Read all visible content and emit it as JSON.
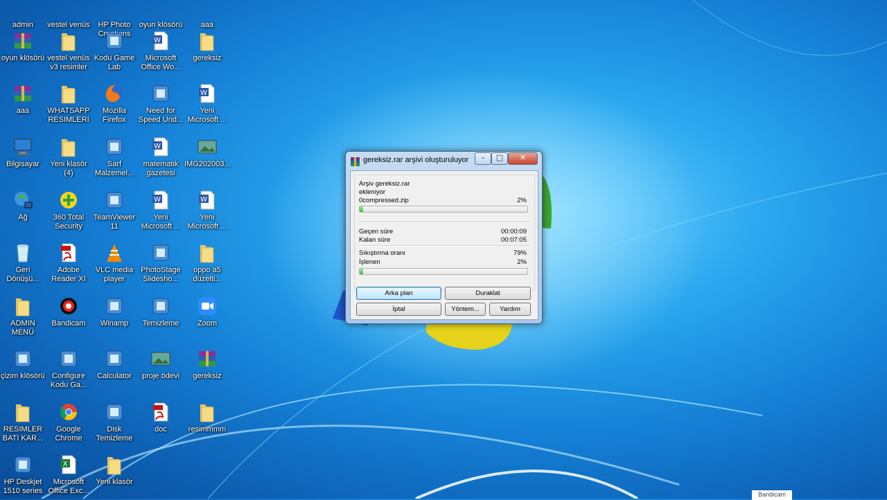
{
  "desktop": {
    "icons": [
      {
        "label": "admin",
        "type": "user"
      },
      {
        "label": "vestel venüs",
        "type": "folder"
      },
      {
        "label": "HP Photo\nCreations",
        "type": "app"
      },
      {
        "label": "oyun klösörü",
        "type": "folder"
      },
      {
        "label": "aaa",
        "type": "folder"
      },
      {
        "label": "oyun klösörü",
        "type": "rar"
      },
      {
        "label": "vestel venüs\nv3 resimler",
        "type": "folder"
      },
      {
        "label": "Kodu Game\nLab",
        "type": "app"
      },
      {
        "label": "Microsoft\nOffice Wo...",
        "type": "word"
      },
      {
        "label": "gereksiz",
        "type": "folder"
      },
      {
        "label": "aaa",
        "type": "rar"
      },
      {
        "label": "WHATSAPP\nRESIMLERI",
        "type": "folder"
      },
      {
        "label": "Mozilla\nFirefox",
        "type": "firefox"
      },
      {
        "label": "Need for\nSpeed Und...",
        "type": "app"
      },
      {
        "label": "Yeni\nMicrosoft ...",
        "type": "word"
      },
      {
        "label": "Bilgisayar",
        "type": "computer"
      },
      {
        "label": "Yeni klasör\n(4)",
        "type": "folder"
      },
      {
        "label": "Sarf\nMalzemel...",
        "type": "app"
      },
      {
        "label": "matematik\ngazetesi",
        "type": "word"
      },
      {
        "label": "IMG202003...",
        "type": "image"
      },
      {
        "label": "Ağ",
        "type": "network"
      },
      {
        "label": "360 Total\nSecurity",
        "type": "shield"
      },
      {
        "label": "TeamViewer\n11",
        "type": "app"
      },
      {
        "label": "Yeni\nMicrosoft ...",
        "type": "word"
      },
      {
        "label": "Yeni\nMicrosoft ...",
        "type": "word"
      },
      {
        "label": "Geri\nDönüşü...",
        "type": "recycle"
      },
      {
        "label": "Adobe\nReader XI",
        "type": "pdf"
      },
      {
        "label": "VLC media\nplayer",
        "type": "vlc"
      },
      {
        "label": "PhotoStage\nSlidesho...",
        "type": "app"
      },
      {
        "label": "oppo a5\ndüzelti...",
        "type": "folder"
      },
      {
        "label": "ADMIN\nMENÜ",
        "type": "folder"
      },
      {
        "label": "Bandicam",
        "type": "bandicam"
      },
      {
        "label": "Winamp",
        "type": "app"
      },
      {
        "label": "Temizleme",
        "type": "app"
      },
      {
        "label": "Zoom",
        "type": "zoom"
      },
      {
        "label": "çizim klösörü",
        "type": "app"
      },
      {
        "label": "Configure\nKodu Ga...",
        "type": "app"
      },
      {
        "label": "Calculator",
        "type": "app"
      },
      {
        "label": "proje ödevi",
        "type": "image"
      },
      {
        "label": "gereksiz",
        "type": "rar"
      },
      {
        "label": "RESIMLER\nBATI KAR...",
        "type": "folder"
      },
      {
        "label": "Google\nChrome",
        "type": "chrome"
      },
      {
        "label": "Disk\nTemizleme",
        "type": "app"
      },
      {
        "label": "doc",
        "type": "pdf"
      },
      {
        "label": "resimmmm",
        "type": "folder"
      },
      {
        "label": "HP Deskjet\n1510 series",
        "type": "app"
      },
      {
        "label": "Microsoft\nOffice Exc...",
        "type": "excel"
      },
      {
        "label": "Yeni klasör",
        "type": "folder"
      }
    ]
  },
  "dialog": {
    "title": "gereksiz.rar arşivi oluşturuluyor",
    "archive_line": "Arşiv gereksiz.rar",
    "action_line": "ekleniyor",
    "file_name": "0compressed.zip",
    "file_percent": "2%",
    "file_progress": 0.02,
    "elapsed_label": "Geçen süre",
    "elapsed_value": "00:00:09",
    "remaining_label": "Kalan süre",
    "remaining_value": "00:07:05",
    "ratio_label": "Sıkıştırma oranı",
    "ratio_value": "79%",
    "processed_label": "İşlenen",
    "processed_value": "2%",
    "total_progress": 0.02,
    "buttons": {
      "background": "Arka plan",
      "pause": "Duraklat",
      "cancel": "İptal",
      "mode": "Yöntem...",
      "help": "Yardım"
    }
  },
  "watermark": "Bandicam"
}
